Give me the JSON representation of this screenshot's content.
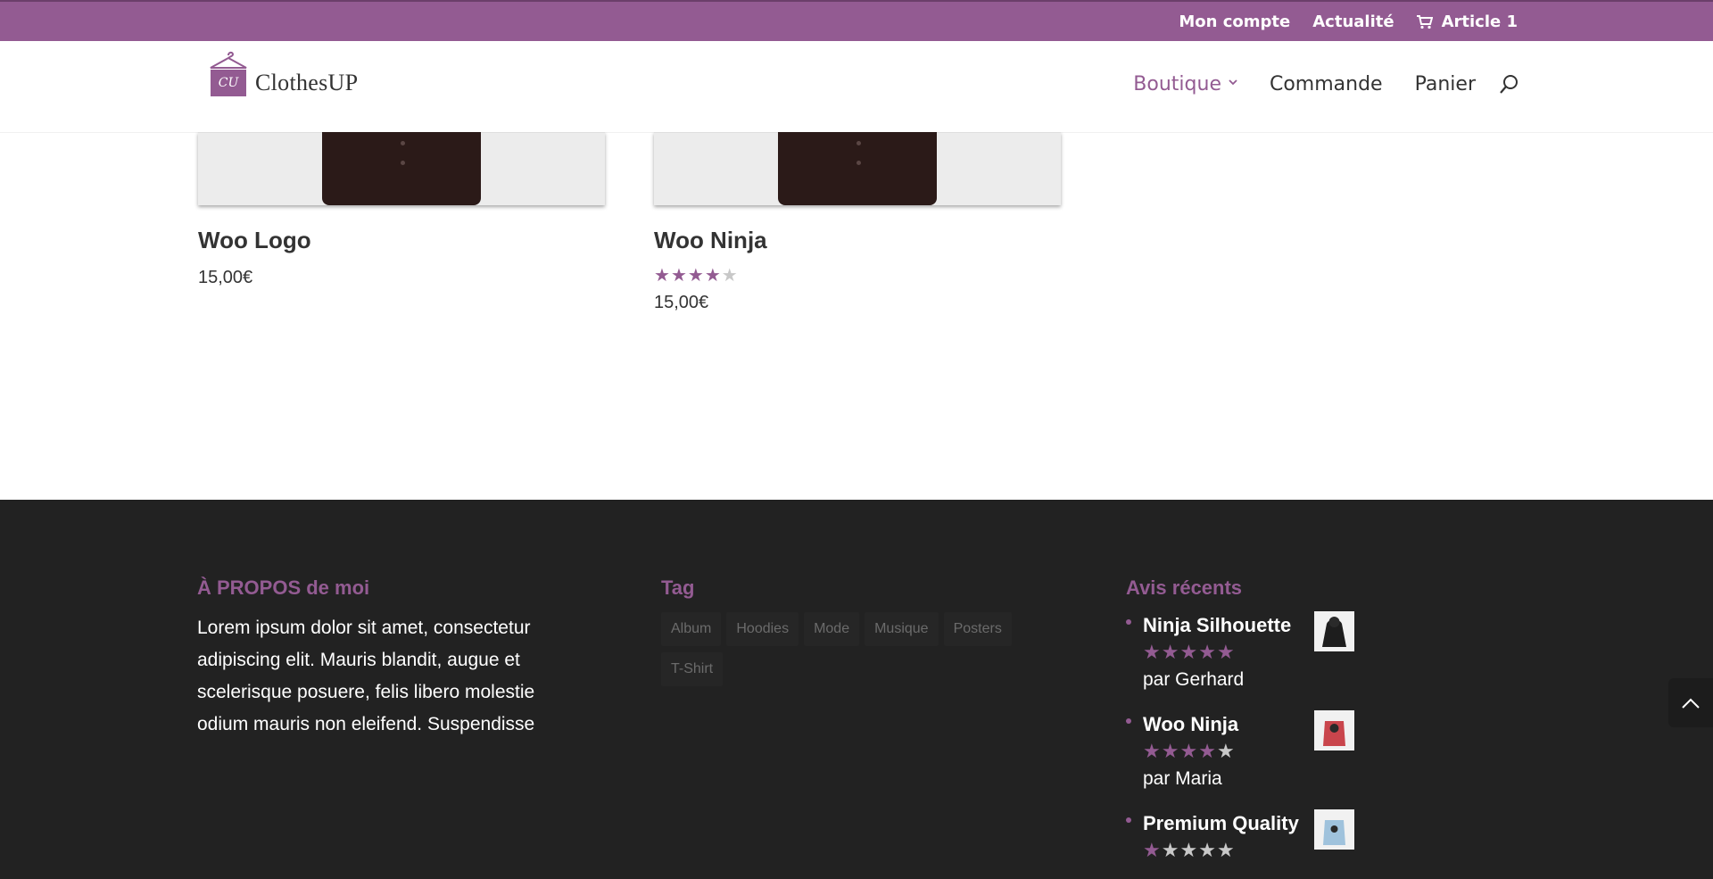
{
  "topbar": {
    "account_label": "Mon compte",
    "news_label": "Actualité",
    "cart_label": "Article 1",
    "cart_icon": "cart-icon"
  },
  "header": {
    "logo_text": "ClothesUP",
    "logo_monogram": "CU",
    "nav": [
      {
        "label": "Boutique",
        "active": true,
        "has_dropdown": true
      },
      {
        "label": "Commande"
      },
      {
        "label": "Panier"
      }
    ],
    "search_icon": "search-icon"
  },
  "products": [
    {
      "title": "Woo Logo",
      "price": "15,00€",
      "rating": null
    },
    {
      "title": "Woo Ninja",
      "price": "15,00€",
      "rating": 4
    }
  ],
  "footer": {
    "about": {
      "title": "À PROPOS de moi",
      "text": "Lorem ipsum dolor sit amet, consectetur adipiscing elit. Mauris blandit, augue et scelerisque posuere, felis libero molestie odium mauris non eleifend. Suspendisse"
    },
    "tags": {
      "title": "Tag",
      "items": [
        "Album",
        "Hoodies",
        "Mode",
        "Musique",
        "Posters",
        "T-Shirt"
      ]
    },
    "reviews": {
      "title": "Avis récents",
      "items": [
        {
          "product": "Ninja Silhouette",
          "author": "par Gerhard",
          "rating": 5
        },
        {
          "product": "Woo Ninja",
          "author": "par Maria",
          "rating": 4
        },
        {
          "product": "Premium Quality",
          "author": "",
          "rating": 1
        }
      ]
    }
  },
  "colors": {
    "accent": "#935b92",
    "footer_bg": "#222222",
    "star_off": "#c8c8c8"
  }
}
